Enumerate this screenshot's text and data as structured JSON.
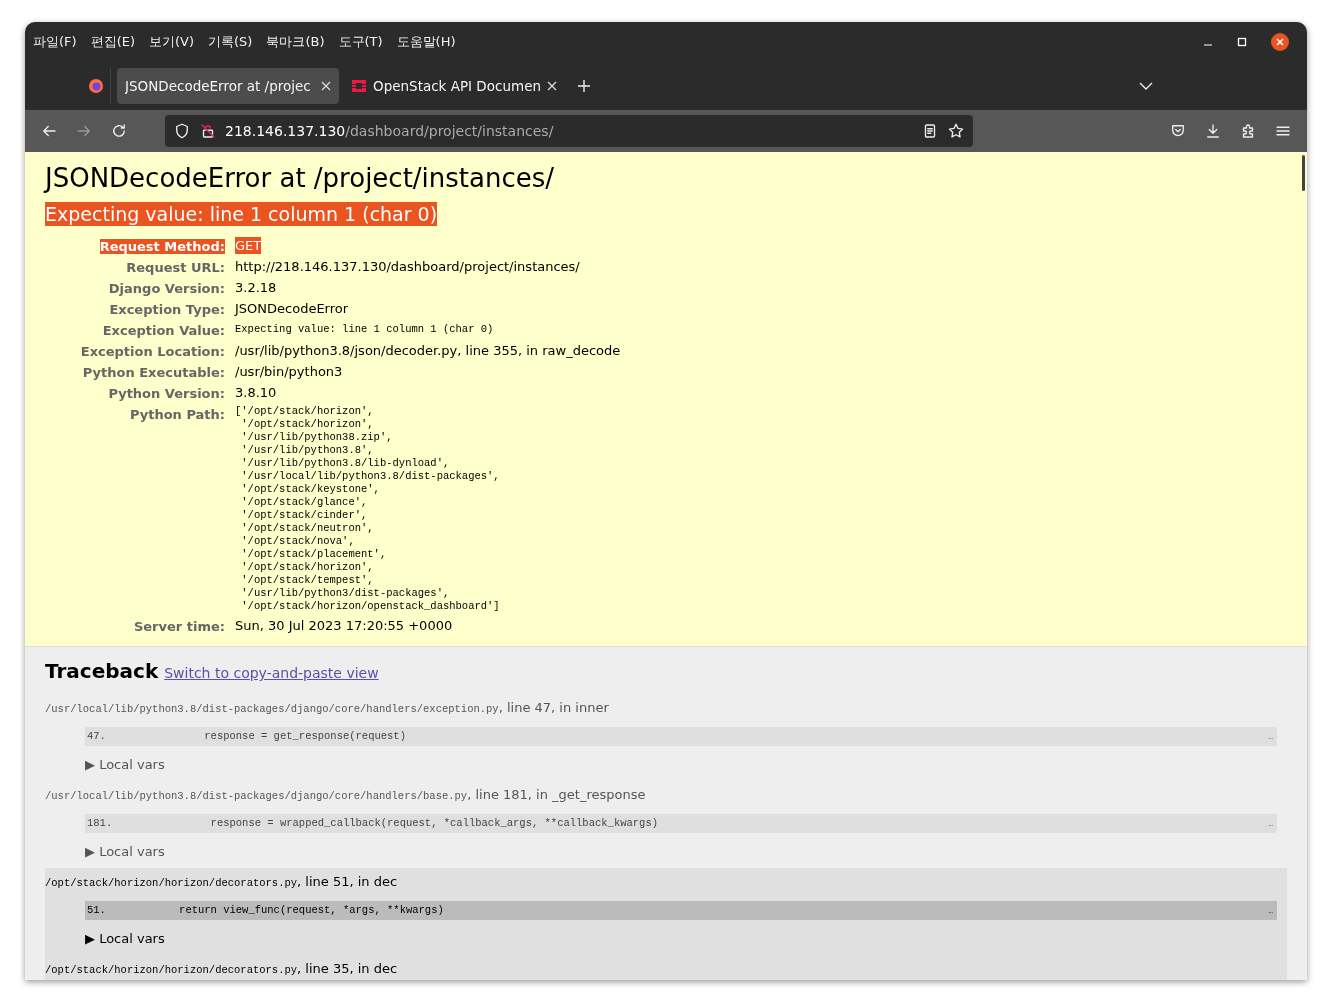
{
  "menu_bar": [
    "파일(F)",
    "편집(E)",
    "보기(V)",
    "기록(S)",
    "북마크(B)",
    "도구(T)",
    "도움말(H)"
  ],
  "tabs": [
    {
      "label": "JSONDecodeError at /projec",
      "selected": true
    },
    {
      "label": "OpenStack API Documen",
      "selected": false
    }
  ],
  "address_bar": {
    "host": "218.146.137.130",
    "path": "/dashboard/project/instances/"
  },
  "summary": {
    "title": "JSONDecodeError at /project/instances/",
    "subtitle": "Expecting value: line 1 column 1 (char 0)",
    "subtitle_highlighted": true
  },
  "meta": [
    {
      "label": "Request Method:",
      "value": "GET",
      "kind": "text",
      "highlighted": true
    },
    {
      "label": "Request URL:",
      "value": "http://218.146.137.130/dashboard/project/instances/",
      "kind": "text",
      "highlighted": false
    },
    {
      "label": "Django Version:",
      "value": "3.2.18",
      "kind": "text",
      "highlighted": false
    },
    {
      "label": "Exception Type:",
      "value": "JSONDecodeError",
      "kind": "text",
      "highlighted": false
    },
    {
      "label": "Exception Value:",
      "value": "Expecting value: line 1 column 1 (char 0)",
      "kind": "mono",
      "highlighted": false
    },
    {
      "label": "Exception Location:",
      "value": "/usr/lib/python3.8/json/decoder.py, line 355, in raw_decode",
      "kind": "text",
      "highlighted": false
    },
    {
      "label": "Python Executable:",
      "value": "/usr/bin/python3",
      "kind": "text",
      "highlighted": false
    },
    {
      "label": "Python Version:",
      "value": "3.8.10",
      "kind": "text",
      "highlighted": false
    },
    {
      "label": "Python Path:",
      "kind": "lines",
      "highlighted": false,
      "lines": [
        "['/opt/stack/horizon',",
        " '/opt/stack/horizon',",
        " '/usr/lib/python38.zip',",
        " '/usr/lib/python3.8',",
        " '/usr/lib/python3.8/lib-dynload',",
        " '/usr/local/lib/python3.8/dist-packages',",
        " '/opt/stack/keystone',",
        " '/opt/stack/glance',",
        " '/opt/stack/cinder',",
        " '/opt/stack/neutron',",
        " '/opt/stack/nova',",
        " '/opt/stack/placement',",
        " '/opt/stack/horizon',",
        " '/opt/stack/tempest',",
        " '/usr/lib/python3/dist-packages',",
        " '/opt/stack/horizon/openstack_dashboard']"
      ]
    },
    {
      "label": "Server time:",
      "value": "Sun, 30 Jul 2023 17:20:55 +0000",
      "kind": "text",
      "highlighted": false
    }
  ],
  "traceback": {
    "title": "Traceback",
    "link": "Switch to copy-and-paste view",
    "frames": [
      {
        "kind": "django",
        "file": "/usr/local/lib/python3.8/dist-packages/django/core/handlers/exception.py",
        "where": ", line 47, in inner",
        "lineno": "47.",
        "code": "           response = get_response(request)",
        "ellipsis": "…",
        "vars": "▶ Local vars"
      },
      {
        "kind": "django",
        "file": "/usr/local/lib/python3.8/dist-packages/django/core/handlers/base.py",
        "where": ", line 181, in _get_response",
        "lineno": "181.",
        "code": "            response = wrapped_callback(request, *callback_args, **callback_kwargs)",
        "ellipsis": "…",
        "vars": "▶ Local vars"
      },
      {
        "kind": "user",
        "file": "/opt/stack/horizon/horizon/decorators.py",
        "where": ", line 51, in dec",
        "lineno": "51.",
        "code": "       return view_func(request, *args, **kwargs)",
        "ellipsis": "…",
        "vars": "▶ Local vars"
      },
      {
        "kind": "user",
        "file": "/opt/stack/horizon/horizon/decorators.py",
        "where": ", line 35, in dec"
      }
    ]
  }
}
